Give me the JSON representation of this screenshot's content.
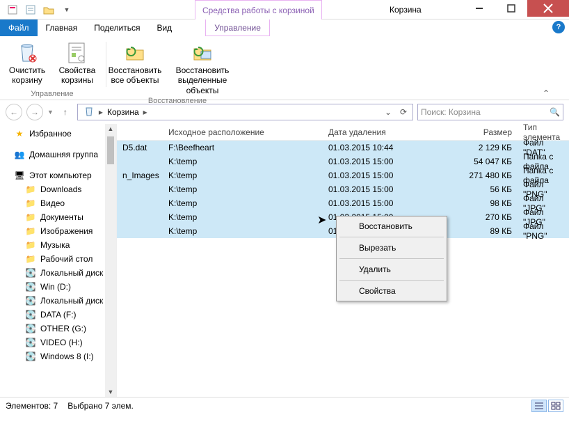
{
  "titlebar": {
    "contextual_label": "Средства работы с корзиной",
    "title": "Корзина"
  },
  "ribbon_tabs": {
    "file": "Файл",
    "home": "Главная",
    "share": "Поделиться",
    "view": "Вид",
    "manage": "Управление"
  },
  "ribbon": {
    "empty": "Очистить корзину",
    "properties": "Свойства корзины",
    "restore_all": "Восстановить все объекты",
    "restore_sel": "Восстановить выделенные объекты",
    "group_manage": "Управление",
    "group_restore": "Восстановление"
  },
  "address": {
    "location": "Корзина",
    "search_placeholder": "Поиск: Корзина"
  },
  "nav": {
    "favorites": "Избранное",
    "homegroup": "Домашняя группа",
    "this_pc": "Этот компьютер",
    "items": [
      "Downloads",
      "Видео",
      "Документы",
      "Изображения",
      "Музыка",
      "Рабочий стол",
      "Локальный диск",
      "Win (D:)",
      "Локальный диск",
      "DATA (F:)",
      "OTHER (G:)",
      "VIDEO (H:)",
      "Windows 8 (I:)"
    ]
  },
  "columns": {
    "name": "",
    "location": "Исходное расположение",
    "date": "Дата удаления",
    "size": "Размер",
    "type": "Тип элемента"
  },
  "rows": [
    {
      "name": "D5.dat",
      "loc": "F:\\Beefheart",
      "date": "01.03.2015 10:44",
      "size": "2 129 КБ",
      "type": "Файл \"DAT\""
    },
    {
      "name": "",
      "loc": "K:\\temp",
      "date": "01.03.2015 15:00",
      "size": "54 047 КБ",
      "type": "Папка с файла"
    },
    {
      "name": "n_Images",
      "loc": "K:\\temp",
      "date": "01.03.2015 15:00",
      "size": "271 480 КБ",
      "type": "Папка с файла"
    },
    {
      "name": "",
      "loc": "K:\\temp",
      "date": "01.03.2015 15:00",
      "size": "56 КБ",
      "type": "Файл \"PNG\""
    },
    {
      "name": "",
      "loc": "K:\\temp",
      "date": "01.03.2015 15:00",
      "size": "98 КБ",
      "type": "Файл \"JPG\""
    },
    {
      "name": "",
      "loc": "K:\\temp",
      "date": "01.03.2015 15:00",
      "size": "270 КБ",
      "type": "Файл \"JPG\""
    },
    {
      "name": "",
      "loc": "K:\\temp",
      "date": "01.03.2015 15:00",
      "size": "89 КБ",
      "type": "Файл \"PNG\""
    }
  ],
  "context_menu": [
    "Восстановить",
    "Вырезать",
    "Удалить",
    "Свойства"
  ],
  "status": {
    "count": "Элементов: 7",
    "selected": "Выбрано 7 элем."
  }
}
